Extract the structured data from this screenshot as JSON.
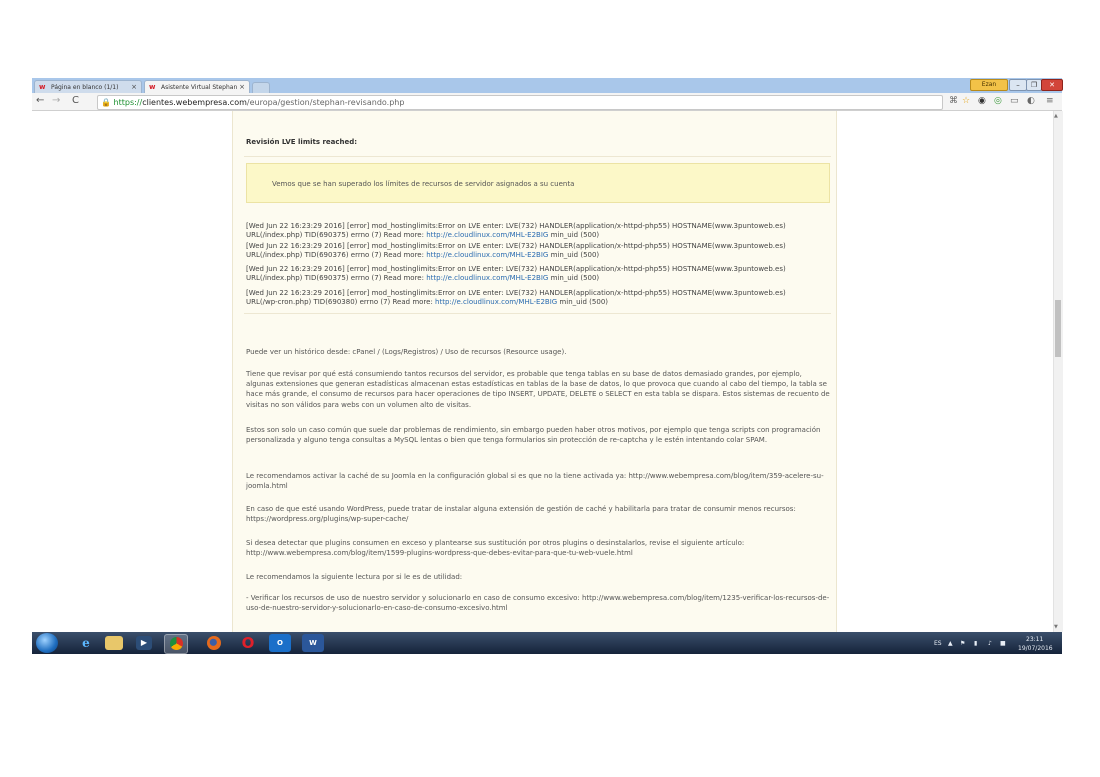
{
  "browser": {
    "tabs": [
      {
        "label": "Página en blanco (1/1)",
        "close": "×"
      },
      {
        "label": "Asistente Virtual Stephan",
        "close": "×"
      }
    ],
    "url_https": "https://",
    "url_host": "clientes.webempresa.com",
    "url_path": "/europa/gestion/stephan-revisando.php",
    "user_badge": "Ezan"
  },
  "page": {
    "heading": "Revisión LVE limits reached:",
    "alert": "Vemos que se han superado los límites de recursos de servidor asignados a su cuenta",
    "log_lines": [
      {
        "pre": "[Wed Jun 22 16:23:29 2016] [error] mod_hostinglimits:Error on LVE enter: LVE(732) HANDLER(application/x-httpd-php55) HOSTNAME(www.3puntoweb.es)",
        "line2_pre": "URL(/index.php) TID(690375) errno (7) Read more: ",
        "link": "http://e.cloudlinux.com/MHL-E2BIG",
        "post": " min_uid (500)"
      },
      {
        "pre": "[Wed Jun 22 16:23:29 2016] [error] mod_hostinglimits:Error on LVE enter: LVE(732) HANDLER(application/x-httpd-php55) HOSTNAME(www.3puntoweb.es)",
        "line2_pre": "URL(/index.php) TID(690376) errno (7) Read more: ",
        "link": "http://e.cloudlinux.com/MHL-E2BIG",
        "post": " min_uid (500)"
      },
      {
        "pre": "[Wed Jun 22 16:23:29 2016] [error] mod_hostinglimits:Error on LVE enter: LVE(732) HANDLER(application/x-httpd-php55) HOSTNAME(www.3puntoweb.es)",
        "line2_pre": "URL(/index.php) TID(690375) errno (7) Read more: ",
        "link": "http://e.cloudlinux.com/MHL-E2BIG",
        "post": " min_uid (500)"
      },
      {
        "pre": "[Wed Jun 22 16:23:29 2016] [error] mod_hostinglimits:Error on LVE enter: LVE(732) HANDLER(application/x-httpd-php55) HOSTNAME(www.3puntoweb.es)",
        "line2_pre": "URL(/wp-cron.php) TID(690380) errno (7) Read more: ",
        "link": "http://e.cloudlinux.com/MHL-E2BIG",
        "post": " min_uid (500)"
      }
    ],
    "paragraphs": [
      "Puede ver un histórico desde: cPanel / (Logs/Registros) / Uso de recursos (Resource usage).",
      "Tiene que revisar por qué está consumiendo tantos recursos del servidor, es probable que tenga tablas en su base de datos demasiado grandes, por ejemplo, algunas extensiones que generan estadísticas almacenan estas estadísticas en tablas de la base de datos, lo que provoca que cuando al cabo del tiempo, la tabla se hace más grande, el consumo de recursos para hacer operaciones de tipo INSERT, UPDATE, DELETE o SELECT en esta tabla se dispara. Estos sistemas de recuento de visitas no son válidos para webs con un volumen alto de visitas.",
      "Estos son solo un caso común que suele dar problemas de rendimiento, sin embargo pueden haber otros motivos, por ejemplo que tenga scripts con programación personalizada y alguno tenga consultas a MySQL lentas o bien que tenga formularios sin protección de re-captcha y le estén intentando colar SPAM.",
      "Le recomendamos activar la caché de su Joomla en la configuración global si es que no la tiene activada ya: http://www.webempresa.com/blog/item/359-acelere-su-joomla.html",
      "En caso de que esté usando WordPress, puede tratar de instalar alguna extensión de gestión de caché y habilitarla para tratar de consumir menos recursos: https://wordpress.org/plugins/wp-super-cache/",
      "Si desea detectar que plugins consumen en exceso y plantearse sus sustitución por otros plugins o desinstalarlos, revise el siguiente artículo: http://www.webempresa.com/blog/item/1599-plugins-wordpress-que-debes-evitar-para-que-tu-web-vuele.html",
      "Le recomendamos la siguiente lectura por si le es de utilidad:",
      "- Verificar los recursos de uso de nuestro servidor y solucionarlo en caso de consumo excesivo: http://www.webempresa.com/blog/item/1235-verificar-los-recursos-de-uso-de-nuestro-servidor-y-solucionarlo-en-caso-de-consumo-excesivo.html"
    ]
  },
  "taskbar": {
    "lang": "ES",
    "time": "23:11",
    "date": "19/07/2016"
  }
}
